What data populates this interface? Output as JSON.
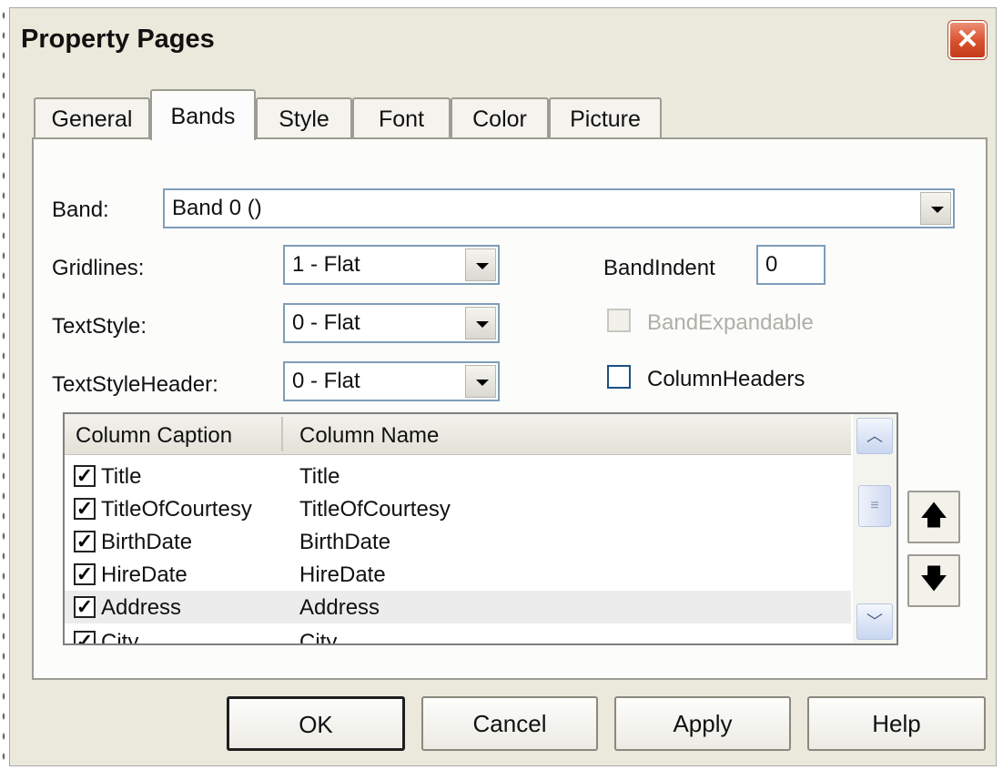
{
  "window": {
    "title": "Property Pages",
    "close_glyph": "✕"
  },
  "tabs": [
    "General",
    "Bands",
    "Style",
    "Font",
    "Color",
    "Picture"
  ],
  "active_tab": "Bands",
  "band": {
    "label": "Band:",
    "value": "Band 0 ()"
  },
  "gridlines": {
    "label": "Gridlines:",
    "value": "1 - Flat"
  },
  "textstyle": {
    "label": "TextStyle:",
    "value": "0 - Flat"
  },
  "textstyleheader": {
    "label": "TextStyleHeader:",
    "value": "0 - Flat"
  },
  "bandindent": {
    "label": "BandIndent",
    "value": "0"
  },
  "bandexpandable": {
    "label": "BandExpandable",
    "checked": false,
    "enabled": false
  },
  "columnheaders": {
    "label": "ColumnHeaders",
    "checked": false
  },
  "columns_list": {
    "headers": [
      "Column Caption",
      "Column Name"
    ],
    "rows": [
      {
        "caption": "Title",
        "name": "Title",
        "checked": true
      },
      {
        "caption": "TitleOfCourtesy",
        "name": "TitleOfCourtesy",
        "checked": true
      },
      {
        "caption": "BirthDate",
        "name": "BirthDate",
        "checked": true
      },
      {
        "caption": "HireDate",
        "name": "HireDate",
        "checked": true
      },
      {
        "caption": "Address",
        "name": "Address",
        "checked": true,
        "selected": true
      },
      {
        "caption": "City",
        "name": "City",
        "checked": true
      }
    ],
    "check_glyph": "✓"
  },
  "move_buttons": {
    "up_glyph": "🡅",
    "down_glyph": "🡇"
  },
  "buttons": {
    "ok": "OK",
    "cancel": "Cancel",
    "apply": "Apply",
    "help": "Help"
  },
  "colors": {
    "dialog_bg": "#ebe9db",
    "panel_bg": "#fcfcfb",
    "close_red": "#d8502e",
    "border_blue": "#7f9db9"
  }
}
